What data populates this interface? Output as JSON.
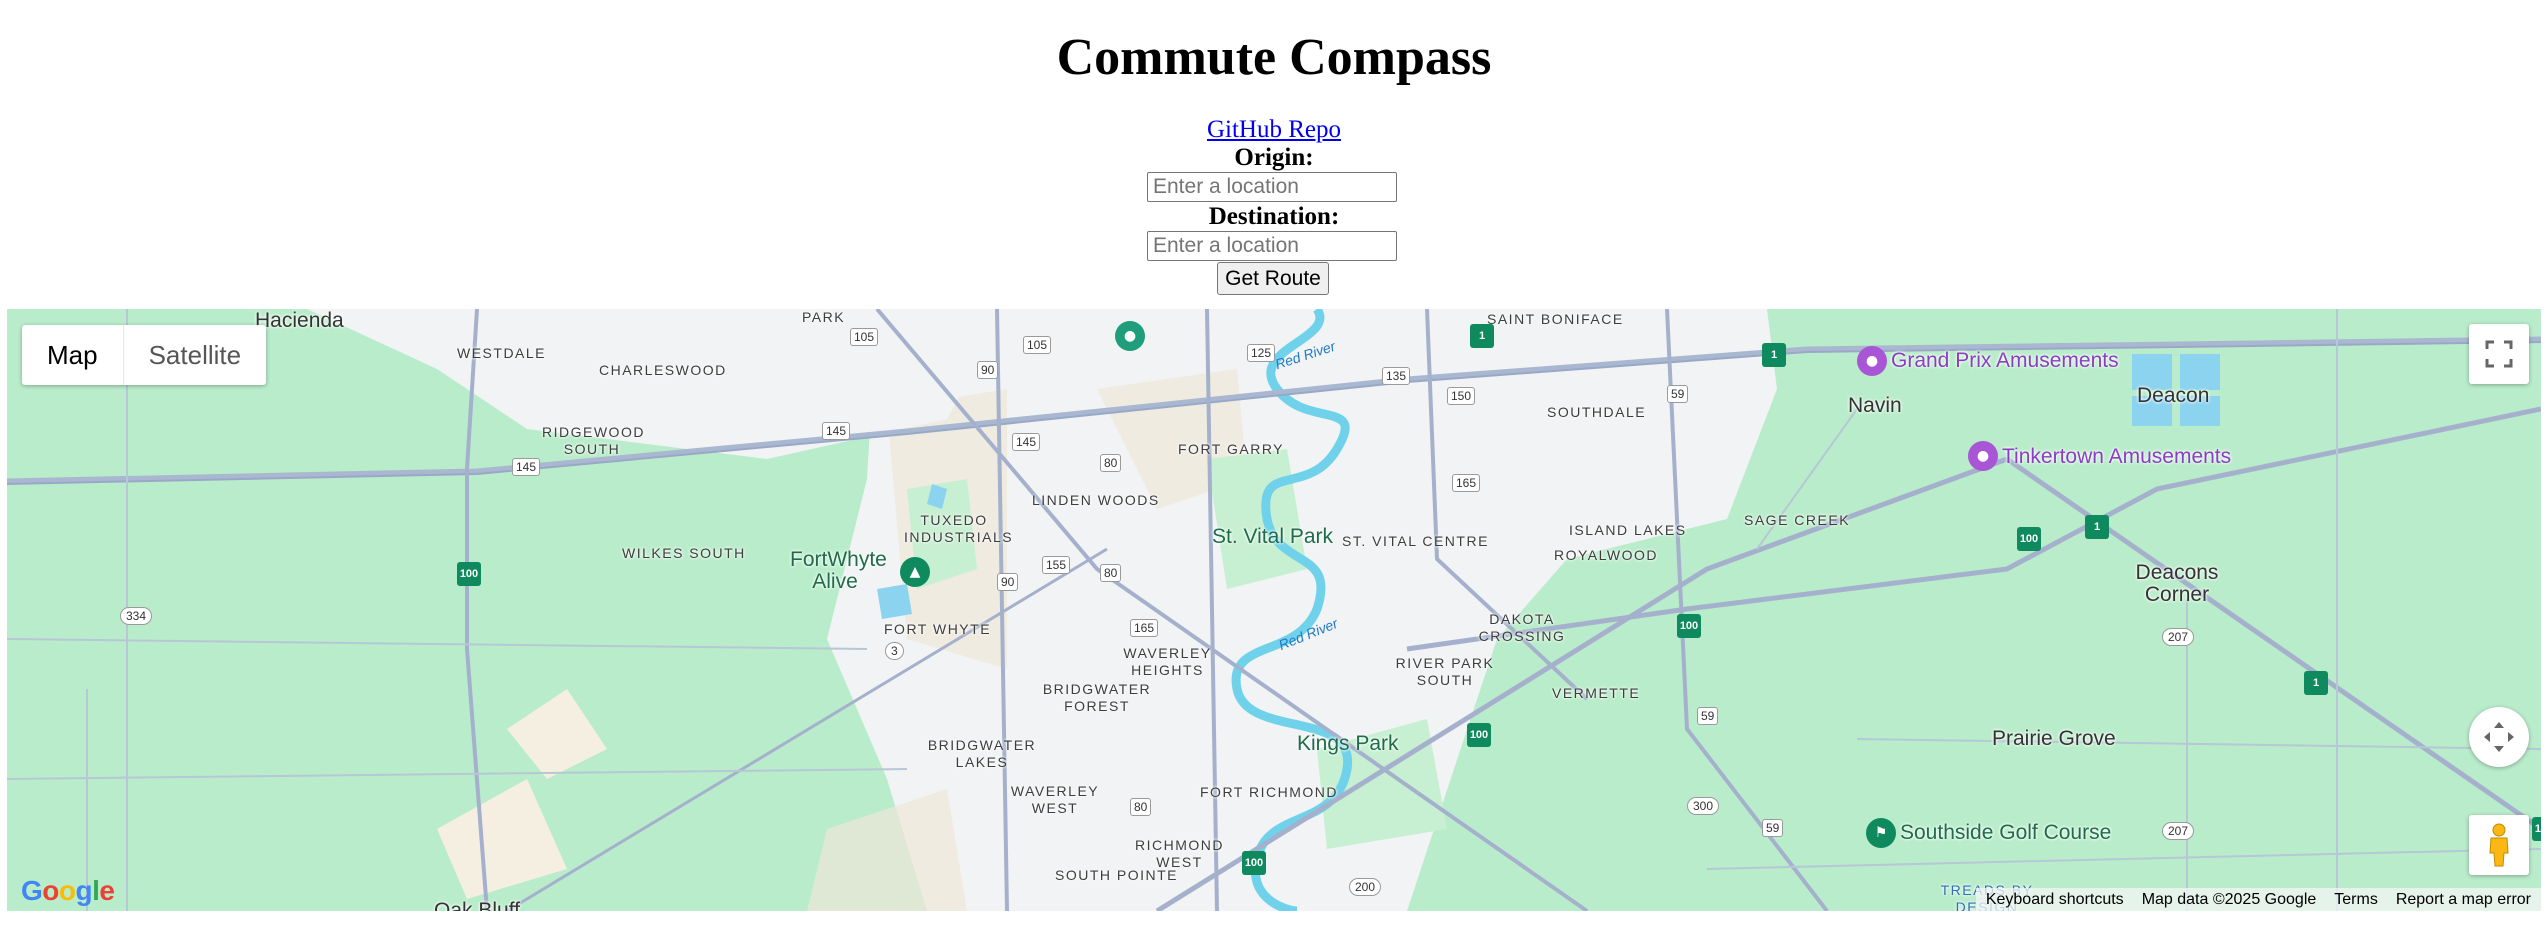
{
  "header": {
    "title": "Commute Compass",
    "repo_link": "GitHub Repo"
  },
  "form": {
    "origin_label": "Origin:",
    "origin_placeholder": "Enter a location",
    "origin_value": "",
    "destination_label": "Destination:",
    "destination_placeholder": "Enter a location",
    "destination_value": "",
    "submit_label": "Get Route"
  },
  "map": {
    "type_controls": [
      "Map",
      "Satellite"
    ],
    "selected_type": "Map",
    "controls": [
      "fullscreen-icon",
      "camera-control-icon",
      "pegman-icon"
    ],
    "logo": "Google",
    "footer": {
      "keyboard": "Keyboard shortcuts",
      "data": "Map data ©2025 Google",
      "terms": "Terms",
      "report": "Report a map error"
    },
    "labels": {
      "cities": [
        "Hacienda",
        "Navin",
        "Deacon",
        "Deacons Corner",
        "Prairie Grove",
        "Oak Bluff"
      ],
      "neighbourhoods": [
        "PARK",
        "WESTDALE",
        "CHARLESWOOD",
        "RIDGEWOOD SOUTH",
        "WILKES SOUTH",
        "TUXEDO INDUSTRIALS",
        "LINDEN WOODS",
        "FORT GARRY",
        "SAINT BONIFACE",
        "SOUTHDALE",
        "ST. VITAL CENTRE",
        "ISLAND LAKES",
        "SAGE CREEK",
        "ROYALWOOD",
        "DAKOTA CROSSING",
        "FORT WHYTE",
        "WAVERLEY HEIGHTS",
        "BRIDGWATER FOREST",
        "BRIDGWATER LAKES",
        "WAVERLEY WEST",
        "RIVER PARK SOUTH",
        "VERMETTE",
        "FORT RICHMOND",
        "RICHMOND WEST",
        "SOUTH POINTE",
        "TREADS BY DESIGN"
      ],
      "parks": [
        "St. Vital Park",
        "FortWhyte Alive",
        "Kings Park"
      ],
      "rivers": [
        "Red River",
        "Red River"
      ],
      "pois": [
        "Grand Prix Amusements",
        "Tinkertown Amusements",
        "Southside Golf Course"
      ],
      "route_shields": [
        "105",
        "105",
        "90",
        "125",
        "135",
        "150",
        "145",
        "145",
        "145",
        "80",
        "155",
        "80",
        "165",
        "165",
        "90",
        "3",
        "334",
        "59",
        "59",
        "59",
        "200",
        "80",
        "300",
        "207",
        "207"
      ],
      "highway_shields": [
        "1",
        "1",
        "1",
        "1",
        "100",
        "100",
        "100",
        "100",
        "100",
        "100"
      ]
    }
  }
}
